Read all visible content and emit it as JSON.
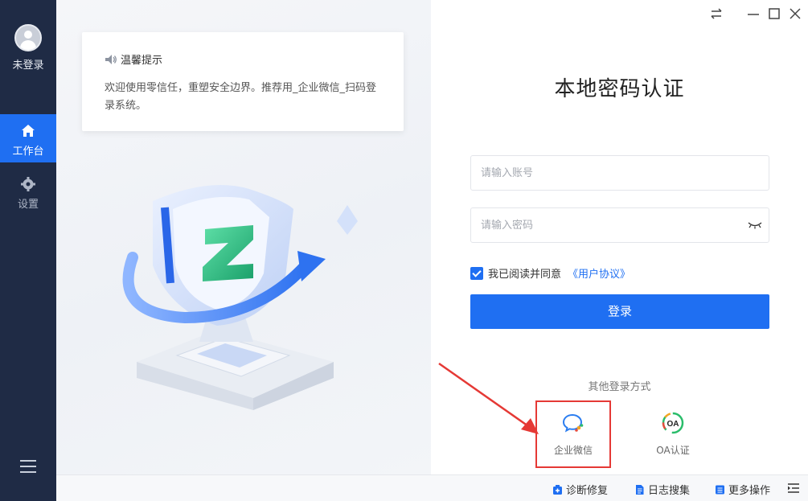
{
  "sidebar": {
    "user_label": "未登录",
    "items": [
      {
        "label": "工作台",
        "icon": "home-icon",
        "active": true
      },
      {
        "label": "设置",
        "icon": "gear-icon",
        "active": false
      }
    ],
    "menu_icon": "hamburger-icon"
  },
  "tip": {
    "title": "温馨提示",
    "body": "欢迎使用零信任，重塑安全边界。推荐用_企业微信_扫码登录系统。"
  },
  "login": {
    "title": "本地密码认证",
    "account_placeholder": "请输入账号",
    "password_placeholder": "请输入密码",
    "agree_text": "我已阅读并同意",
    "agree_link": "《用户协议》",
    "agreed": true,
    "button_label": "登录",
    "other_title": "其他登录方式",
    "methods": [
      {
        "label": "企业微信",
        "icon": "wecom-icon"
      },
      {
        "label": "OA认证",
        "icon": "oa-icon"
      }
    ]
  },
  "bottom_bar": {
    "items": [
      {
        "label": "诊断修复",
        "icon": "repair-icon"
      },
      {
        "label": "日志搜集",
        "icon": "log-icon"
      },
      {
        "label": "更多操作",
        "icon": "more-icon"
      }
    ]
  },
  "colors": {
    "sidebar_bg": "#1f2b45",
    "accent": "#1f6ff2",
    "annotation": "#e53935"
  }
}
